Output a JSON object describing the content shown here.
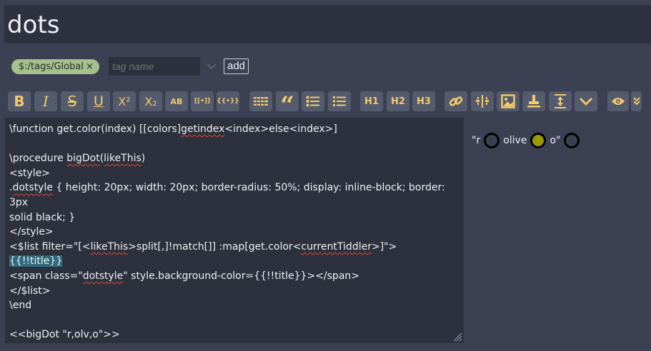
{
  "tiddler": {
    "title": "dots"
  },
  "tags": {
    "items": [
      {
        "label": "$:/tags/Global",
        "remove": "×"
      }
    ],
    "input_placeholder": "tag name",
    "add_label": "add"
  },
  "toolbar": {
    "bold": "B",
    "italic": "I",
    "strike": "S",
    "underline": "U",
    "superscript": "X²",
    "subscript": "X₂",
    "smallcaps": "AB",
    "link": "[[•]]",
    "transclude": "{{•}}",
    "h1": "H1",
    "h2": "H2",
    "h3": "H3"
  },
  "editor": {
    "lines": [
      [
        "\\function get.color(index) [[colors]",
        {
          "sq": "getindex"
        },
        "<index>else<index>]"
      ],
      [
        ""
      ],
      [
        "\\procedure ",
        {
          "sq": "bigDot"
        },
        "(",
        {
          "sq": "likeThis"
        },
        ")"
      ],
      [
        "<style>"
      ],
      [
        ".",
        {
          "sq": "dotstyle"
        },
        " { height: 20px; width: 20px; border-radius: 50%; display: inline-block; border: 3px"
      ],
      [
        "solid black; }"
      ],
      [
        "</style>"
      ],
      [
        "<$list filter=\"[<",
        {
          "sq": "likeThis"
        },
        ">split[,]!match[]] :map[get.color<",
        {
          "sq": "currentTiddler"
        },
        ">]\">"
      ],
      [
        {
          "hl": "{{!!title}}"
        }
      ],
      [
        "<span class=\"",
        {
          "sq": "dotstyle"
        },
        "\" style.background-color={{!!title}}></span>"
      ],
      [
        "</$list>"
      ],
      [
        "\\end"
      ],
      [
        ""
      ],
      [
        "<<bigDot \"r,olv,o\">>"
      ]
    ]
  },
  "preview": {
    "items": [
      {
        "type": "text",
        "value": "\"r"
      },
      {
        "type": "dot",
        "color": "transparent"
      },
      {
        "type": "text",
        "value": "olive"
      },
      {
        "type": "dot",
        "color": "#9a9a00"
      },
      {
        "type": "text",
        "value": "o\""
      },
      {
        "type": "dot",
        "color": "transparent"
      }
    ]
  },
  "colors": {
    "background": "#3b4152",
    "title_bar": "#2e3240",
    "editor_bg": "#2d313d",
    "toolbar_button": "#545b6c",
    "toolbar_icon": "#f2c96c",
    "tag_pill": "#a3c08d",
    "highlight": "#2e6b7d",
    "spell_error": "#e0443c"
  }
}
